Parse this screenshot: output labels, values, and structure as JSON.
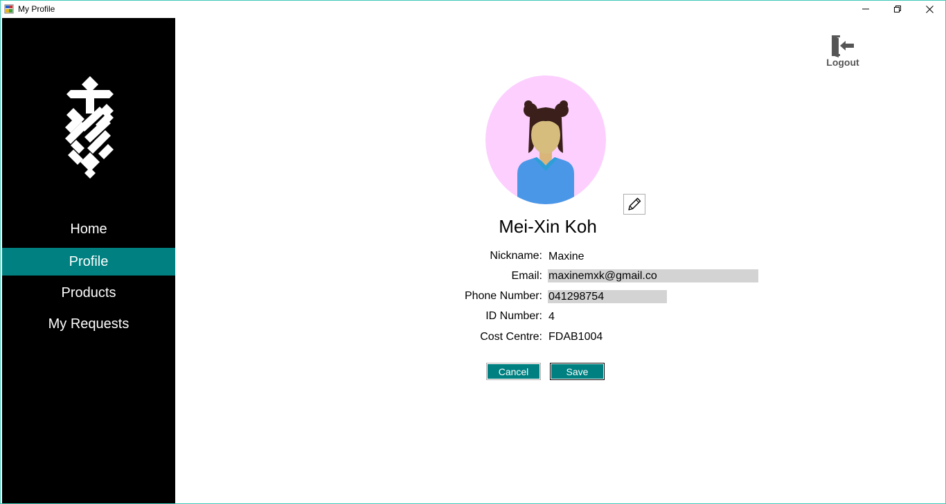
{
  "window": {
    "title": "My Profile"
  },
  "sidebar": {
    "items": [
      {
        "label": "Home",
        "active": false
      },
      {
        "label": "Profile",
        "active": true
      },
      {
        "label": "Products",
        "active": false
      },
      {
        "label": "My Requests",
        "active": false
      }
    ]
  },
  "header": {
    "logout_label": "Logout"
  },
  "profile": {
    "full_name": "Mei-Xin Koh",
    "fields": {
      "nickname": {
        "label": "Nickname:",
        "value": "Maxine"
      },
      "email": {
        "label": "Email:",
        "value": "maxinemxk@gmail.co"
      },
      "phone": {
        "label": "Phone Number:",
        "value": "041298754"
      },
      "id_number": {
        "label": "ID Number:",
        "value": "4"
      },
      "cost_centre": {
        "label": "Cost Centre:",
        "value": "FDAB1004"
      }
    }
  },
  "actions": {
    "cancel_label": "Cancel",
    "save_label": "Save"
  },
  "colors": {
    "sidebar_bg": "#000000",
    "accent": "#008080",
    "avatar_bg": "#fccfff",
    "input_bg": "#d3d3d3"
  },
  "icons": {
    "app": "app-icon",
    "minimize": "minimize-icon",
    "maximize": "restore-icon",
    "close": "close-icon",
    "logo": "logo-icon",
    "logout": "logout-door-icon",
    "edit": "pencil-icon",
    "avatar": "avatar-girl-icon"
  }
}
